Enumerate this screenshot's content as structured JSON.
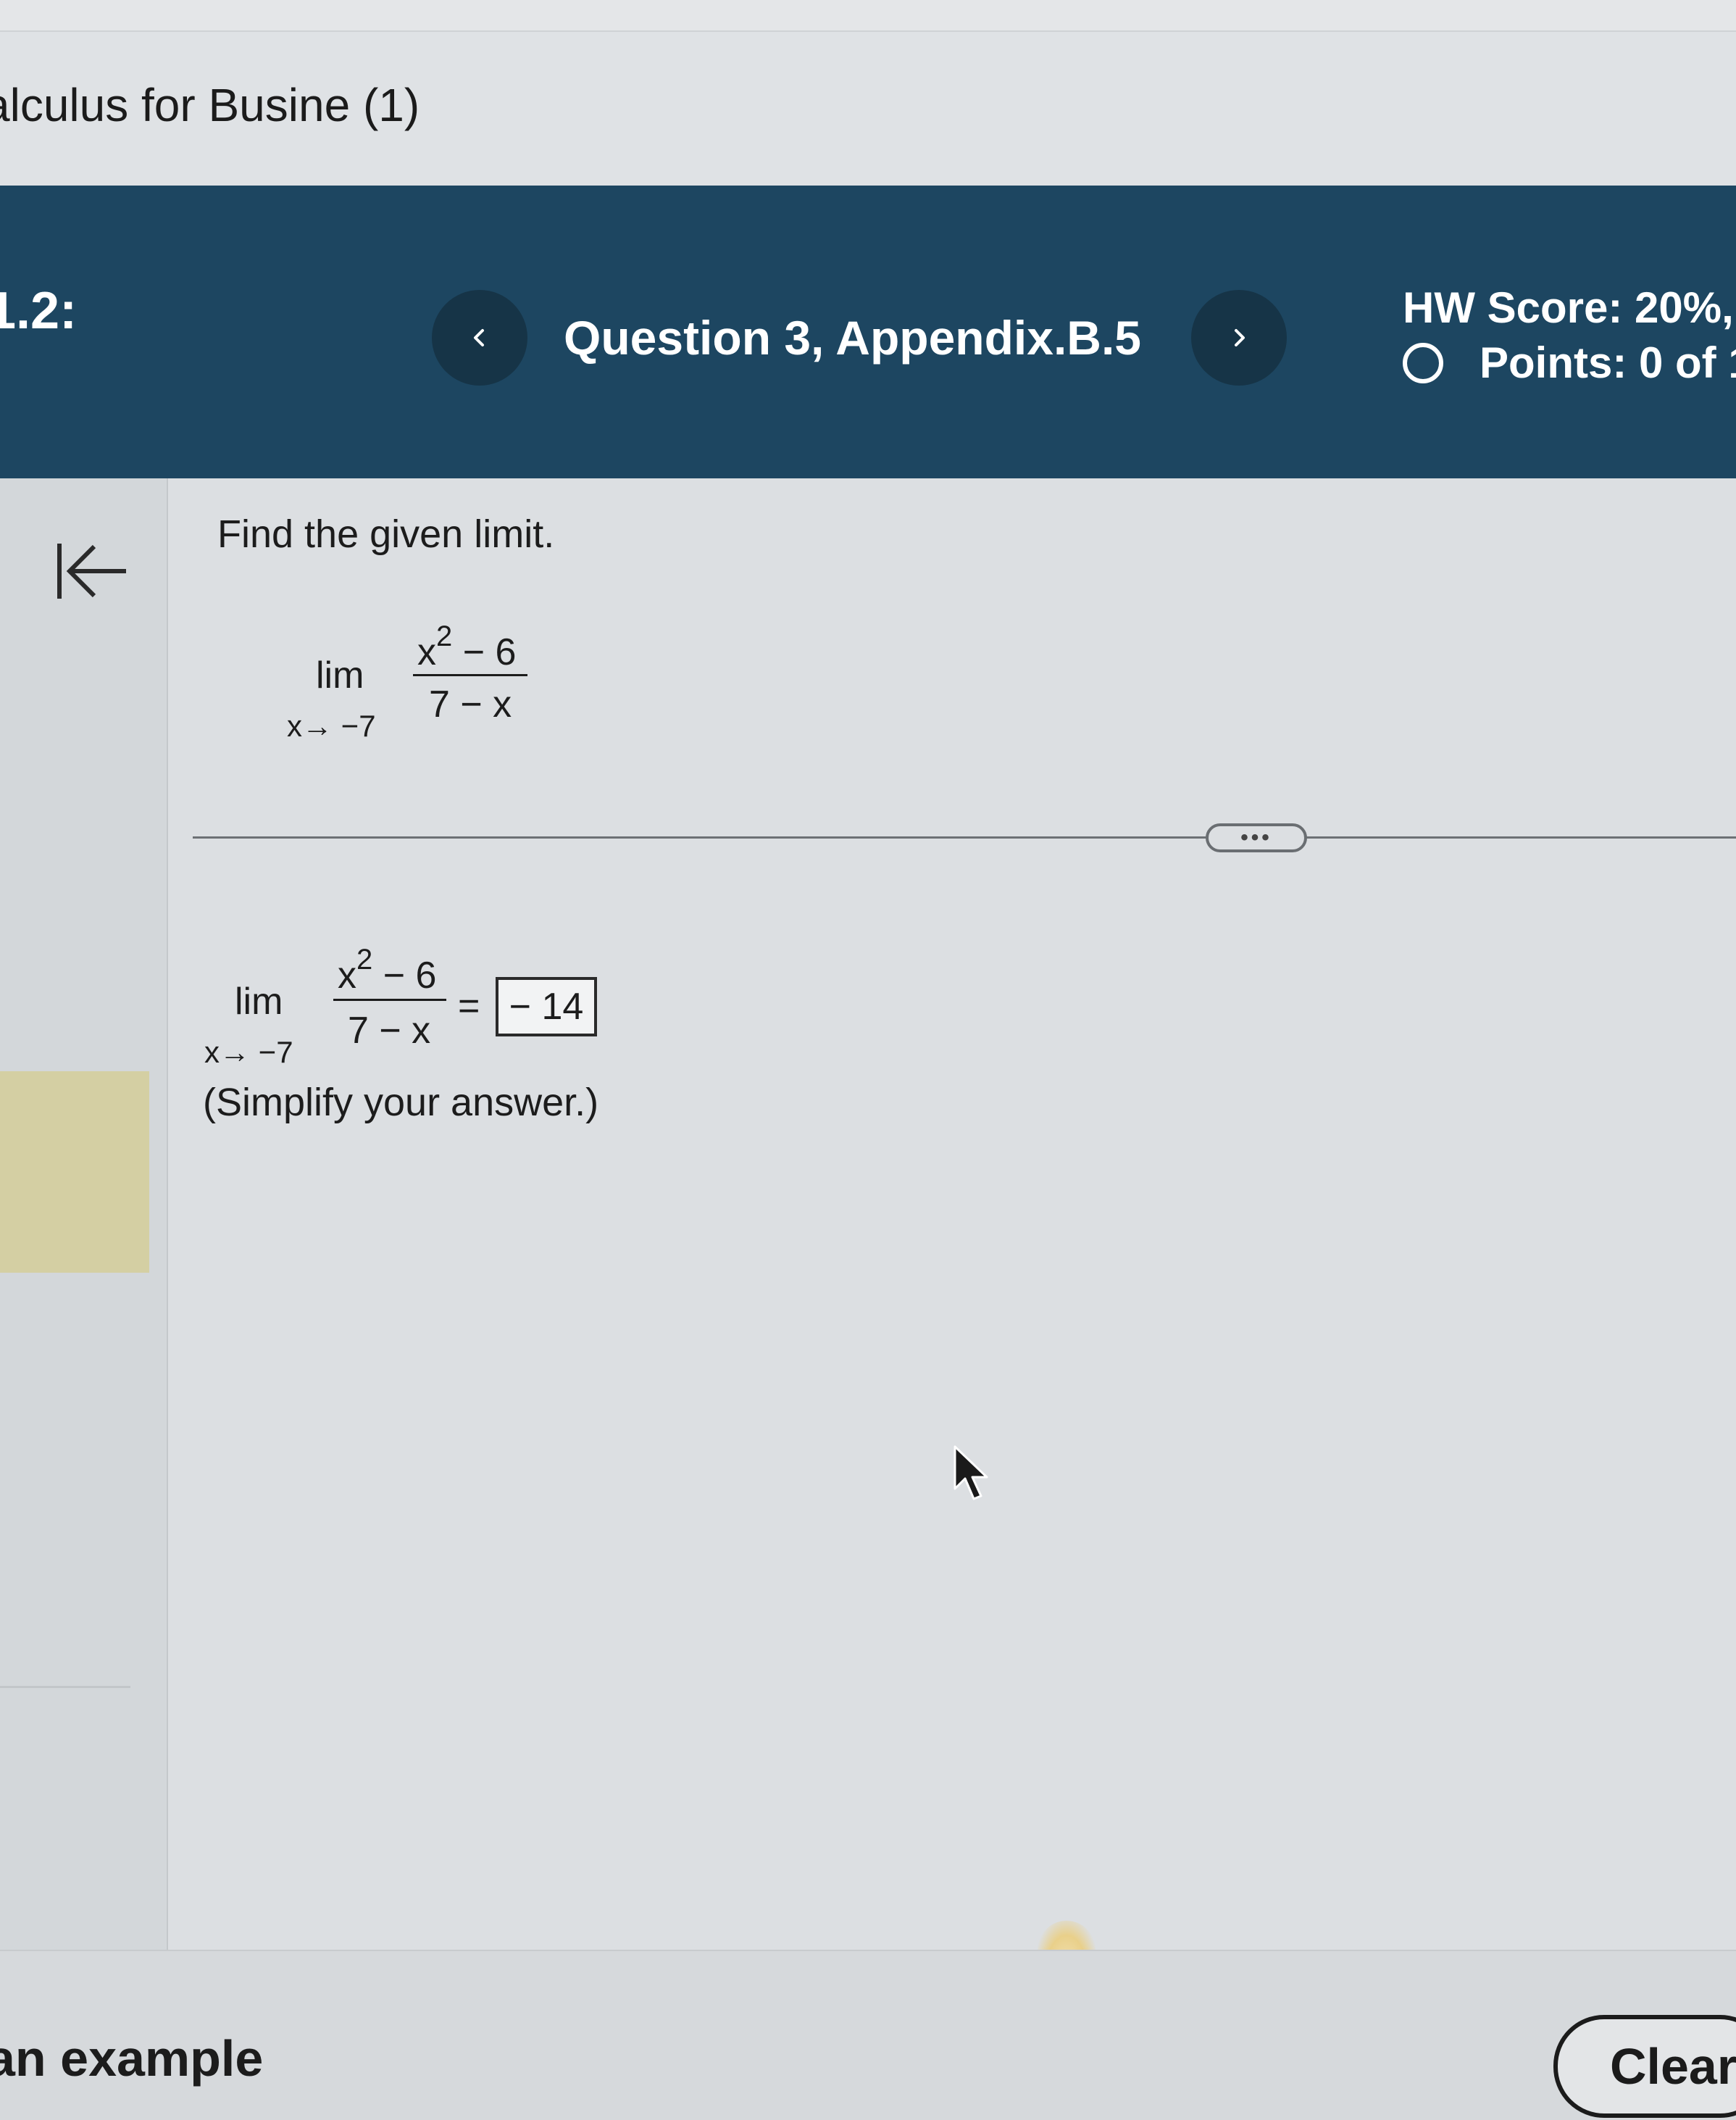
{
  "course": {
    "title": "alculus for Busine (1)"
  },
  "header": {
    "section": "1.2:",
    "question_title": "Question 3, Appendix.B.5",
    "hw_score": "HW Score: 20%,",
    "points": "Points: 0 of 1"
  },
  "question": {
    "prompt": "Find the given limit.",
    "limit_word": "lim",
    "limit_sub": "x→ −7",
    "numerator_base": "x",
    "numerator_exp": "2",
    "numerator_rest": " − 6",
    "denominator": "7 − x",
    "equals": "=",
    "answer": "− 14",
    "instruction": "(Simplify your answer.)"
  },
  "footer": {
    "example_label": "an example",
    "clear_label": "Clear"
  },
  "colors": {
    "header_bg": "#1d4661",
    "nav_button_bg": "#163447",
    "highlight_block": "#d4cfa3"
  }
}
